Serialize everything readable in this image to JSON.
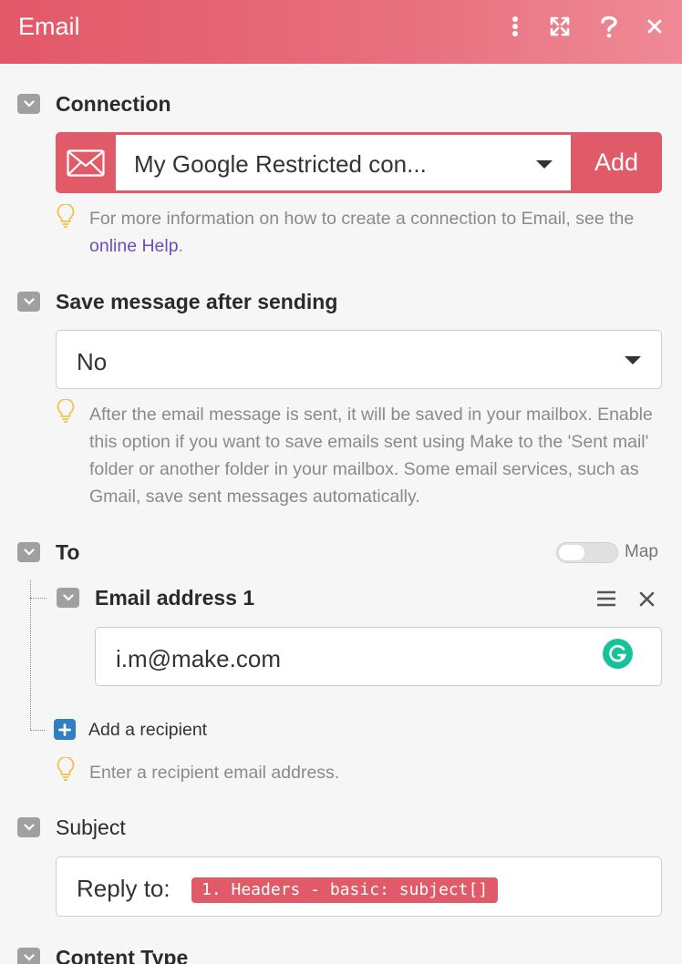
{
  "header": {
    "title": "Email"
  },
  "colors": {
    "accent": "#e05a67",
    "link": "#6b4fbb",
    "grammarly": "#15c39a",
    "add_icon": "#2f7fc1"
  },
  "connection": {
    "label": "Connection",
    "selected": "My Google Restricted con...",
    "add_label": "Add",
    "hint_before": "For more information on how to create a connection to Email, see the",
    "hint_link": "online Help",
    "hint_after": "."
  },
  "save_message": {
    "label": "Save message after sending",
    "selected": "No",
    "hint": "After the email message is sent, it will be saved in your mailbox. Enable this option if you want to save emails sent using Make to the 'Sent mail' folder or another folder in your mailbox. Some email services, such as Gmail, save sent messages automatically."
  },
  "to": {
    "label": "To",
    "map_label": "Map",
    "map_enabled": false,
    "item_label": "Email address 1",
    "item_value": "i.m@make.com",
    "add_recipient": "Add a recipient",
    "hint": "Enter a recipient email address."
  },
  "subject": {
    "label": "Subject",
    "prefix": "Reply to:",
    "pill": "1. Headers - basic: subject[]"
  },
  "content_type": {
    "label": "Content Type"
  },
  "icons": [
    "more-vertical-icon",
    "expand-icon",
    "help-icon",
    "close-icon",
    "chevron-down-icon",
    "envelope-icon",
    "caret-down-icon",
    "lightbulb-icon",
    "drag-handle-icon",
    "remove-icon",
    "plus-icon",
    "grammarly-icon"
  ]
}
